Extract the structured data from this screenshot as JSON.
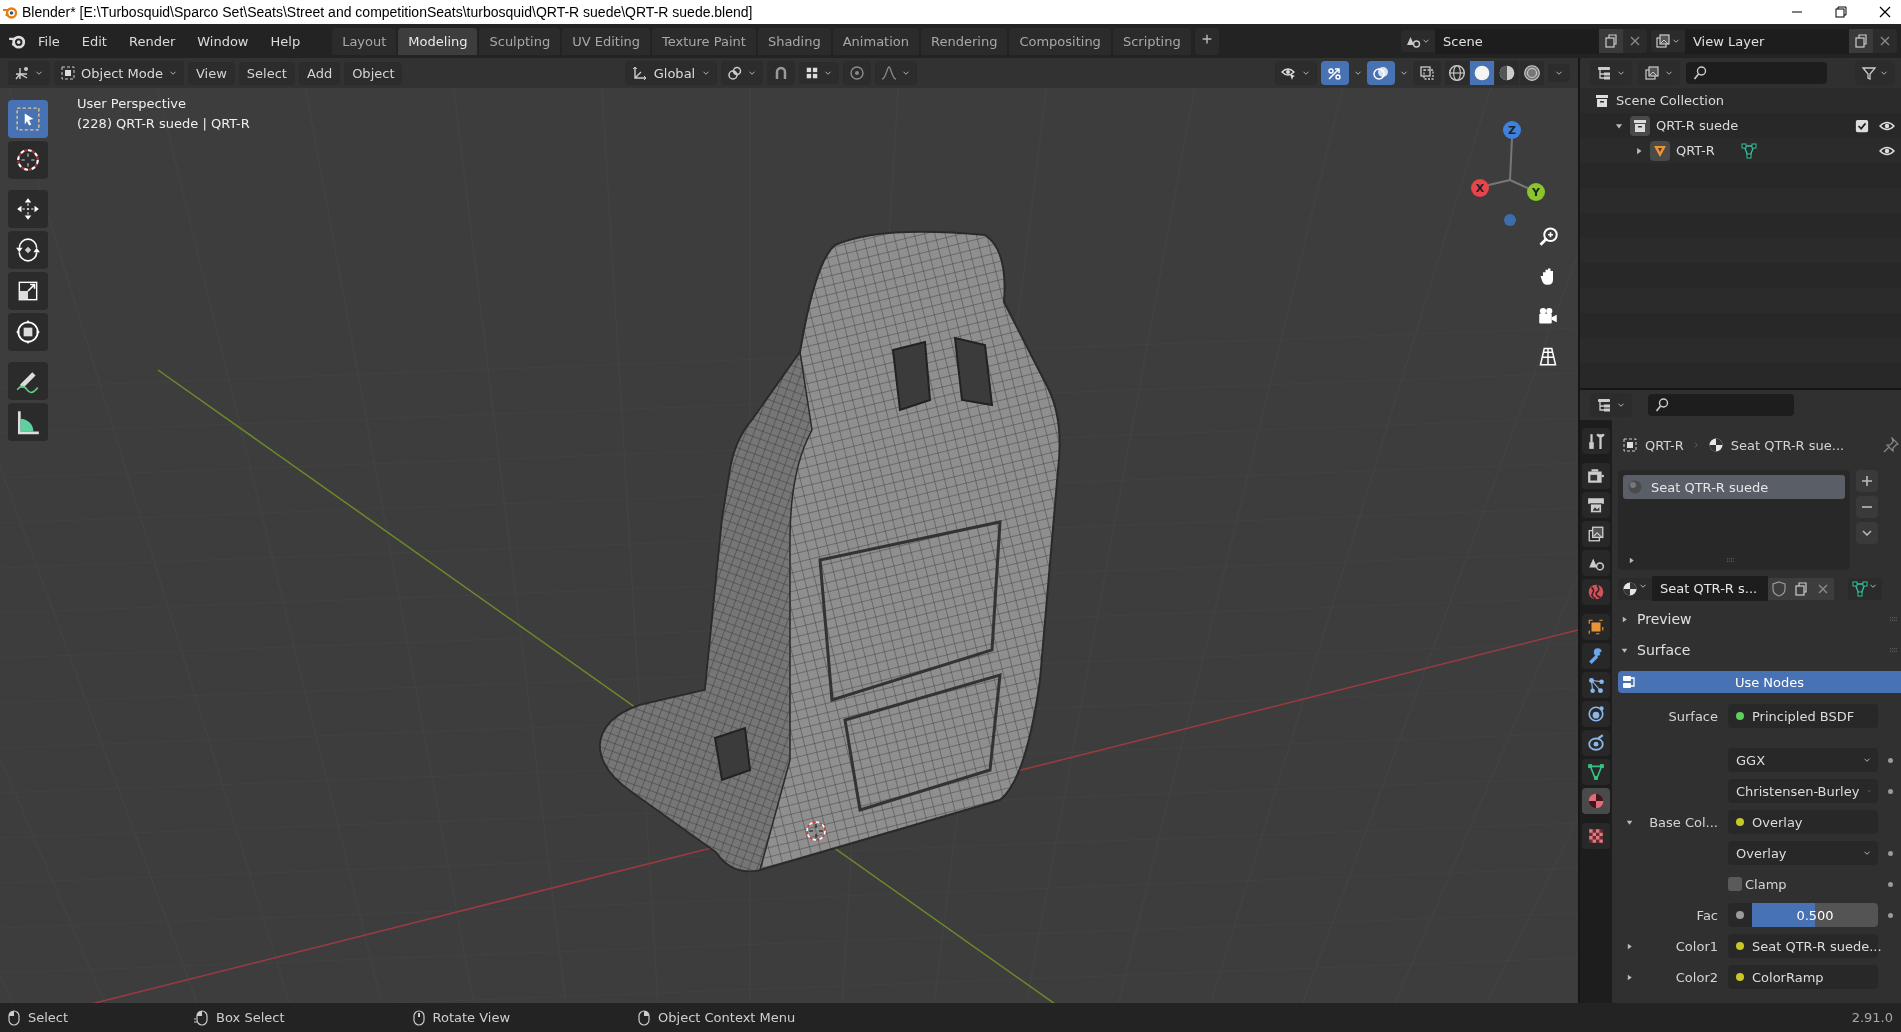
{
  "window": {
    "title": "Blender* [E:\\Turbosquid\\Sparco Set\\Seats\\Street and competitionSeats\\turbosquid\\QRT-R suede\\QRT-R suede.blend]"
  },
  "menu": [
    "File",
    "Edit",
    "Render",
    "Window",
    "Help"
  ],
  "workspaces": [
    {
      "label": "Layout",
      "selected": false
    },
    {
      "label": "Modeling",
      "selected": true
    },
    {
      "label": "Sculpting",
      "selected": false
    },
    {
      "label": "UV Editing",
      "selected": false
    },
    {
      "label": "Texture Paint",
      "selected": false
    },
    {
      "label": "Shading",
      "selected": false
    },
    {
      "label": "Animation",
      "selected": false
    },
    {
      "label": "Rendering",
      "selected": false
    },
    {
      "label": "Compositing",
      "selected": false
    },
    {
      "label": "Scripting",
      "selected": false
    }
  ],
  "scene": {
    "name": "Scene"
  },
  "view_layer": {
    "name": "View Layer"
  },
  "viewport_header": {
    "mode": "Object Mode",
    "menus": [
      "View",
      "Select",
      "Add",
      "Object"
    ],
    "orientation": "Global",
    "gizmos": true,
    "overlays": true,
    "shading": [
      {
        "kind": "wireframe",
        "selected": false
      },
      {
        "kind": "solid",
        "selected": true
      },
      {
        "kind": "material",
        "selected": false
      },
      {
        "kind": "rendered",
        "selected": false
      }
    ]
  },
  "tools": [
    {
      "kind": "select",
      "selected": true
    },
    {
      "kind": "cursor",
      "selected": false
    },
    {
      "kind": "move",
      "selected": false
    },
    {
      "kind": "rotate",
      "selected": false
    },
    {
      "kind": "scale",
      "selected": false
    },
    {
      "kind": "transform",
      "selected": false
    },
    {
      "kind": "annotate",
      "selected": false
    },
    {
      "kind": "measure",
      "selected": false
    }
  ],
  "viewport": {
    "info": [
      "User Perspective",
      "(228) QRT-R suede | QRT-R"
    ],
    "gizmo_axes": [
      {
        "label": "X",
        "color": "#e5454b"
      },
      {
        "label": "Y",
        "color": "#8ac52c"
      },
      {
        "label": "Z",
        "color": "#3e82e0"
      }
    ]
  },
  "outliner": {
    "tree": [
      {
        "label": "Scene Collection",
        "kind": "scene",
        "children": [
          {
            "label": "QRT-R suede",
            "kind": "collection",
            "expanded": true,
            "included": true,
            "children": [
              {
                "label": "QRT-R",
                "kind": "mesh",
                "expanded": false
              }
            ]
          }
        ]
      }
    ]
  },
  "properties": {
    "tabs": [
      {
        "kind": "tool",
        "selected": false
      },
      {
        "kind": "render",
        "selected": false
      },
      {
        "kind": "output",
        "selected": false
      },
      {
        "kind": "viewlayer",
        "selected": false
      },
      {
        "kind": "scene",
        "selected": false
      },
      {
        "kind": "world",
        "selected": false
      },
      {
        "kind": "object",
        "selected": false
      },
      {
        "kind": "modifier",
        "selected": false
      },
      {
        "kind": "particles",
        "selected": false
      },
      {
        "kind": "physics",
        "selected": false
      },
      {
        "kind": "constraints",
        "selected": false
      },
      {
        "kind": "data",
        "selected": false
      },
      {
        "kind": "material",
        "selected": true
      },
      {
        "kind": "texture",
        "selected": false
      }
    ],
    "breadcrumb": [
      "QRT-R",
      "Seat QTR-R sue..."
    ],
    "slots": [
      {
        "name": "Seat QTR-R suede",
        "selected": true
      }
    ],
    "material": "Seat QTR-R s...",
    "panels": [
      {
        "title": "Preview",
        "expanded": false
      },
      {
        "title": "Surface",
        "expanded": true,
        "use_nodes": "Use Nodes",
        "inputs": [
          {
            "kind": "link",
            "label": "Surface",
            "value": "Principled BSDF",
            "color": "#5fcf5f"
          },
          {
            "kind": "menu",
            "value": "GGX"
          },
          {
            "kind": "menu",
            "value": "Christensen-Burley"
          },
          {
            "kind": "link-group",
            "label": "Base Col...",
            "value": "Overlay",
            "color": "#c7c729",
            "expanded": true
          },
          {
            "kind": "menu",
            "value": "Overlay"
          },
          {
            "kind": "checkbox",
            "label": "Clamp",
            "checked": false
          },
          {
            "kind": "slider",
            "label": "Fac",
            "reading": "0.500",
            "level": 0.5
          },
          {
            "kind": "link-group",
            "label": "Color1",
            "value": "Seat QTR-R suede...",
            "color": "#c7c729",
            "expanded": false
          },
          {
            "kind": "link-group",
            "label": "Color2",
            "value": "ColorRamp",
            "color": "#c7c729",
            "expanded": false
          }
        ]
      }
    ]
  },
  "status_bar": {
    "items": [
      {
        "kind": "leftclick",
        "label": "Select"
      },
      {
        "kind": "leftdrag",
        "label": "Box Select"
      },
      {
        "kind": "middleclick",
        "label": "Rotate View"
      },
      {
        "kind": "rightclick",
        "label": "Object Context Menu"
      }
    ],
    "version": "2.91.0"
  }
}
